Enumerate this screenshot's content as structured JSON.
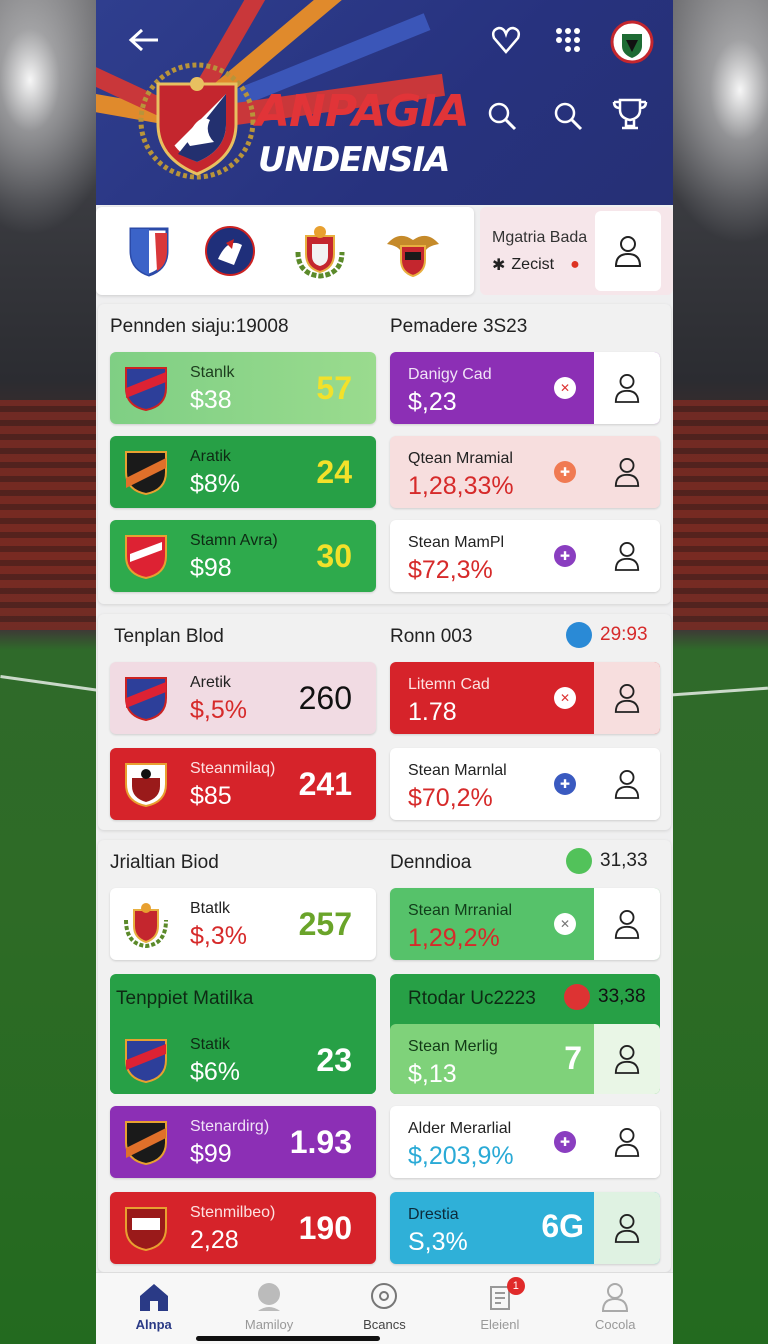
{
  "header": {
    "title_line1": "ANPAGIA",
    "title_line2": "UNDENSIA"
  },
  "profile": {
    "line1": "Mgatria Bada",
    "line2": "Zecist"
  },
  "section1": {
    "left_title": "Pennden siaju:19008",
    "right_title": "Pemadere 3S23",
    "left_tiles": [
      {
        "label": "Stanlk",
        "value": "$38",
        "big": "57"
      },
      {
        "label": "Aratik",
        "value": "$8%",
        "big": "24"
      },
      {
        "label": "Stamn Avra)",
        "value": "$98",
        "big": "30"
      }
    ],
    "right_tiles": [
      {
        "label": "Danigy Cad",
        "value": "$,23"
      },
      {
        "label": "Qtean Mramial",
        "value": "1,28,33%"
      },
      {
        "label": "Stean MamPl",
        "value": "$72,3%"
      }
    ]
  },
  "section2": {
    "left_title": "Tenplan Blod",
    "right_title": "Ronn 003",
    "right_stat": "29:93",
    "left_tiles": [
      {
        "label": "Aretik",
        "value": "$,5%",
        "big": "260"
      },
      {
        "label": "Steanmilaq)",
        "value": "$85",
        "big": "241"
      }
    ],
    "right_tiles": [
      {
        "label": "Litemn Cad",
        "value": "1.78"
      },
      {
        "label": "Stean Marnlal",
        "value": "$70,2%"
      }
    ]
  },
  "section3": {
    "left_title": "Jrialtian Biod",
    "right_title": "Denndioa",
    "right_stat": "31,33",
    "left_tiles": [
      {
        "label": "Btatlk",
        "value": "$,3%",
        "big": "257"
      }
    ],
    "right_tiles": [
      {
        "label": "Stean Mrranial",
        "value": "1,29,2%"
      }
    ],
    "left_group_title": "Tenppiet Matilka",
    "right_group_title": "Rtodar Uc2223",
    "right_group_stat": "33,38",
    "left_tiles2": [
      {
        "label": "Statik",
        "value": "$6%",
        "big": "23"
      },
      {
        "label": "Stenardirg)",
        "value": "$99",
        "big": "1.93"
      },
      {
        "label": "Stenmilbeo)",
        "value": "2,28",
        "big": "190"
      }
    ],
    "right_tiles2": [
      {
        "label": "Stean Merlig",
        "value": "$,13",
        "big": "7"
      },
      {
        "label": "Alder Merarlial",
        "value": "$,203,9%"
      },
      {
        "label": "Drestia",
        "value": "S,3%",
        "big": "6G"
      }
    ]
  },
  "nav": {
    "items": [
      "Alnpa",
      "Mamiloy",
      "Bcancs",
      "Eleienl",
      "Cocola"
    ],
    "badge": "1"
  }
}
